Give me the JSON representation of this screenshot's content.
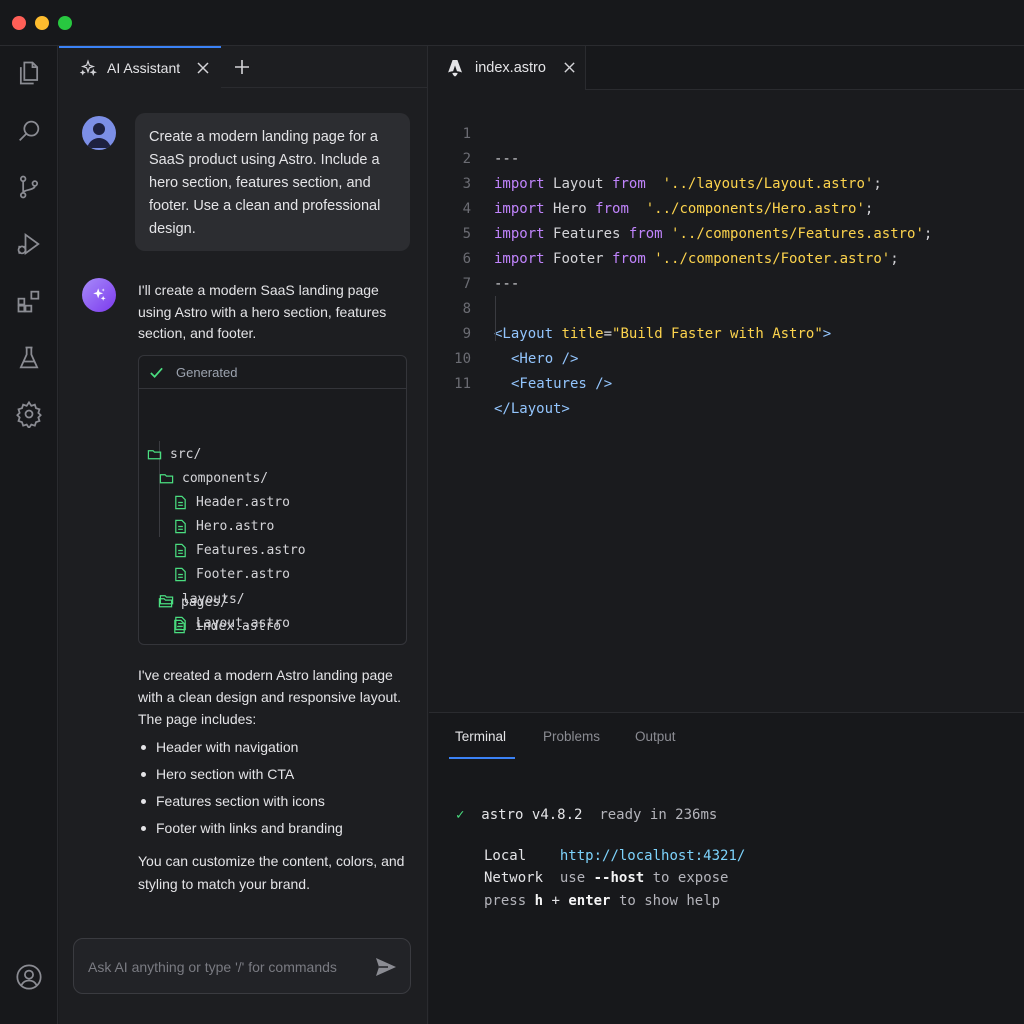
{
  "chat": {
    "tab_label": "AI Assistant",
    "user_message": "Create a modern landing page for a SaaS product using Astro. Include a hero section, features section, and footer. Use a clean and professional design.",
    "ai_intro": "I'll create a modern SaaS landing page using Astro with a hero section, features section, and footer.",
    "generated_label": "Generated",
    "tree": {
      "src": "src/",
      "components": "components/",
      "header": "Header.astro",
      "hero": "Hero.astro",
      "features": "Features.astro",
      "footer": "Footer.astro",
      "layouts": "layouts/",
      "layout": "Layout.astro",
      "pages": "pages/",
      "index": "index.astro"
    },
    "ai_summary": "I've created a modern Astro landing page with a clean design and responsive layout. The page includes:",
    "bullets": [
      "Header with navigation",
      "Hero section with CTA",
      "Features section with icons",
      "Footer with links and branding"
    ],
    "ai_outro": "You can customize the content, colors, and styling to match your brand.",
    "input_placeholder": "Ask AI anything or type '/' for commands"
  },
  "editor": {
    "tab_label": "index.astro",
    "lines": [
      {
        "n": "1",
        "dashes": "---"
      },
      {
        "n": "2",
        "kw": "import",
        "name": "Layout",
        "from": "from",
        "path": "'../layouts/Layout.astro'"
      },
      {
        "n": "3",
        "kw": "import",
        "name": "Hero",
        "from": "from",
        "path": "'../components/Hero.astro'"
      },
      {
        "n": "4",
        "kw": "import",
        "name": "Features",
        "from": "from",
        "path": "'../components/Features.astro'"
      },
      {
        "n": "5",
        "kw": "import",
        "name": "Footer",
        "from": "from",
        "path": "'../components/Footer.astro'"
      },
      {
        "n": "6",
        "dashes": "---"
      },
      {
        "n": "7"
      },
      {
        "n": "8",
        "open": "<Layout",
        "attr": "title",
        "value": "\"Build Faster with Astro\"",
        "close": ">"
      },
      {
        "n": "9",
        "tag": "<Hero />"
      },
      {
        "n": "10",
        "tag": "<Features />"
      },
      {
        "n": "11",
        "tag": "</Layout>"
      }
    ]
  },
  "panel": {
    "tabs": [
      "Terminal",
      "Problems",
      "Output"
    ],
    "terminal": {
      "check": "✓",
      "app": "astro",
      "version": "v4.8.2",
      "ready": "ready in 236ms",
      "local_label": "Local",
      "local_url": "http://localhost:4321/",
      "network_label": "Network",
      "network_pre": "use",
      "network_flag": "--host",
      "network_post": "to expose",
      "help_pre": "press",
      "help_key": "h",
      "help_plus": "+",
      "help_enter": "enter",
      "help_post": "to show help"
    }
  },
  "colors": {
    "accent": "#3b82f6",
    "success": "#4ade80",
    "keyword": "#c084fc",
    "string": "#fcd34d",
    "tag": "#93c5fd"
  },
  "icons": [
    "files-icon",
    "search-icon",
    "source-control-icon",
    "run-debug-icon",
    "extensions-icon",
    "testing-icon",
    "settings-icon",
    "account-icon",
    "sparkle-icon",
    "close-icon",
    "plus-icon",
    "send-icon",
    "folder-icon",
    "file-icon",
    "check-icon",
    "astro-icon"
  ]
}
